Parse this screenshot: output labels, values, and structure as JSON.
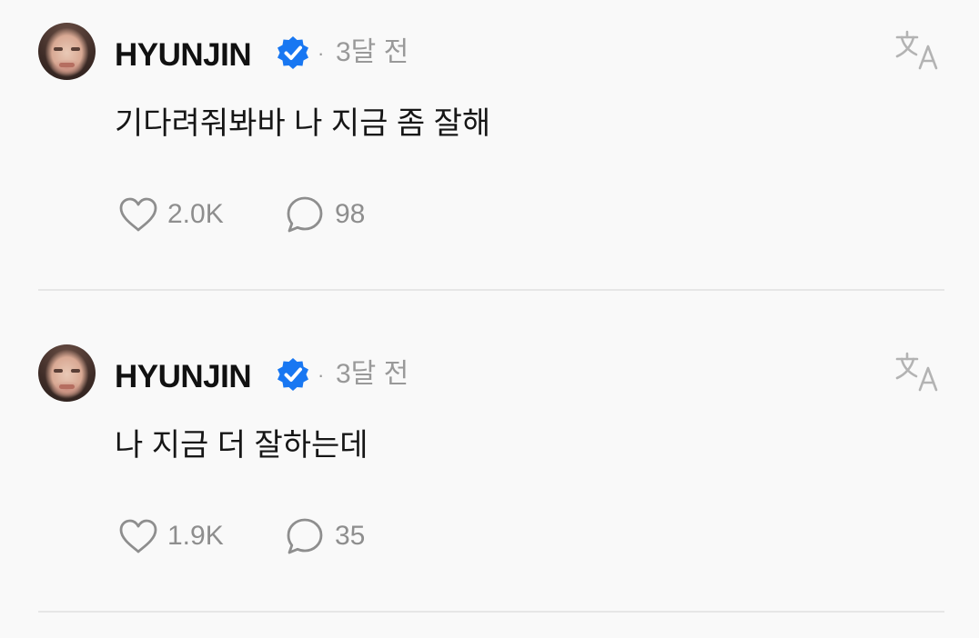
{
  "posts": [
    {
      "username": "HYUNJIN",
      "separator": "·",
      "time": "3달 전",
      "text": "기다려줘봐바 나 지금 좀 잘해",
      "likes": "2.0K",
      "comments": "98"
    },
    {
      "username": "HYUNJIN",
      "separator": "·",
      "time": "3달 전",
      "text": "나 지금 더 잘하는데",
      "likes": "1.9K",
      "comments": "35"
    }
  ],
  "icons": {
    "verified": "verified-badge-icon",
    "translate": "translate-icon",
    "like": "heart-icon",
    "comment": "comment-bubble-icon"
  },
  "colors": {
    "verified": "#1877F2",
    "muted": "#8e8e8e",
    "background": "#f9f9f9"
  }
}
